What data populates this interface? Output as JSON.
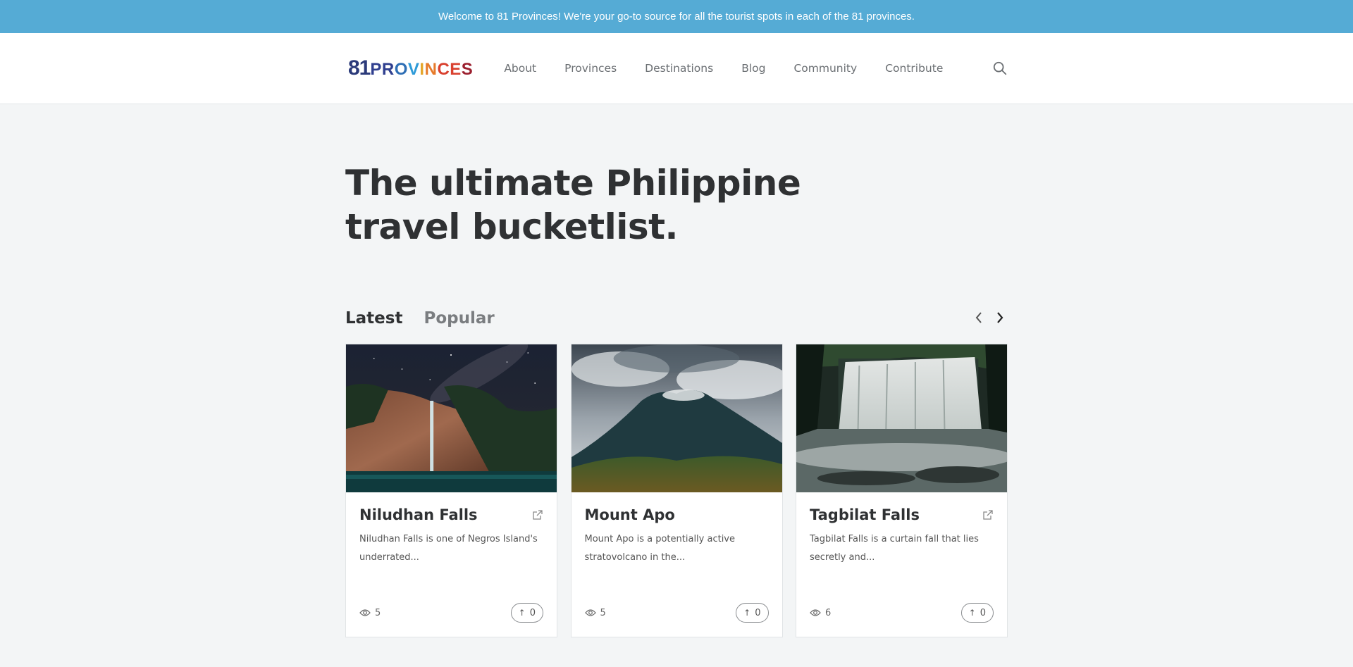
{
  "topbar": {
    "message": "Welcome to 81 Provinces! We're your go-to source for all the tourist spots in each of the 81 provinces."
  },
  "brand": {
    "number": "81",
    "letters": [
      "P",
      "R",
      "O",
      "V",
      "I",
      "N",
      "C",
      "E",
      "S"
    ]
  },
  "nav": {
    "items": [
      "About",
      "Provinces",
      "Destinations",
      "Blog",
      "Community",
      "Contribute"
    ]
  },
  "search": {
    "icon": "search-icon"
  },
  "hero": {
    "title": "The ultimate Philippine travel bucketlist."
  },
  "tabs": {
    "latest": "Latest",
    "popular": "Popular"
  },
  "cards": [
    {
      "title": "Niludhan Falls",
      "description": "Niludhan Falls is one of Negros Island's underrated...",
      "views": "5",
      "upvotes": "0",
      "external_link": true
    },
    {
      "title": "Mount Apo",
      "description": "Mount Apo is a potentially active stratovolcano in the...",
      "views": "5",
      "upvotes": "0",
      "external_link": false
    },
    {
      "title": "Tagbilat Falls",
      "description": "Tagbilat Falls is a curtain fall that lies secretly and...",
      "views": "6",
      "upvotes": "0",
      "external_link": true
    }
  ],
  "colors": {
    "topbar": "#55abd5",
    "background": "#f3f5f6",
    "text": "#2f3133"
  }
}
